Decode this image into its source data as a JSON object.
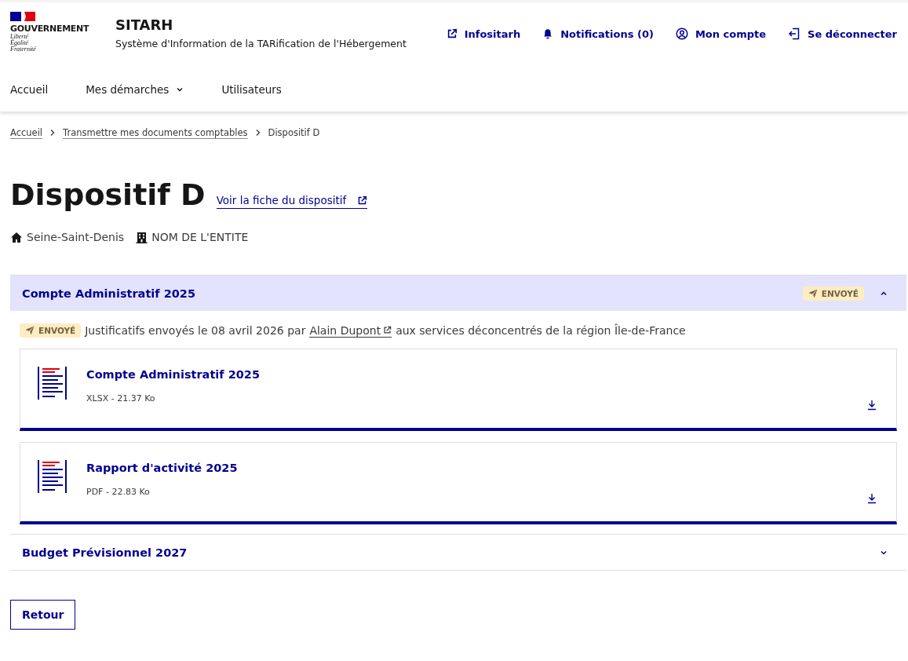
{
  "header": {
    "logo": {
      "title": "GOUVERNEMENT",
      "motto": [
        "Liberté",
        "Égalité",
        "Fraternité"
      ]
    },
    "site_title": "SITARH",
    "site_subtitle": "Système d'Information de la TARification de l'Hébergement",
    "links": [
      {
        "kind": "external",
        "label": "Infositarh"
      },
      {
        "kind": "bell",
        "label": "Notifications (0)"
      },
      {
        "kind": "account",
        "label": "Mon compte"
      },
      {
        "kind": "logout",
        "label": "Se déconnecter"
      }
    ]
  },
  "nav": [
    {
      "label": "Accueil",
      "dropdown": false
    },
    {
      "label": "Mes démarches",
      "dropdown": true
    },
    {
      "label": "Utilisateurs",
      "dropdown": false
    }
  ],
  "breadcrumb": [
    {
      "label": "Accueil",
      "current": false
    },
    {
      "label": "Transmettre mes documents comptables",
      "current": false
    },
    {
      "label": "Dispositif D",
      "current": true
    }
  ],
  "title": "Dispositif D",
  "fiche_link": "Voir la fiche du dispositif",
  "location": "Seine-Saint-Denis",
  "entity": "NOM DE L'ENTITE",
  "sections": [
    {
      "title": "Compte Administratif 2025",
      "expanded": true,
      "status": "ENVOYÉ",
      "notice": {
        "status": "ENVOYÉ",
        "before": "Justificatifs envoyés le 08 avril 2026 par",
        "author": "Alain Dupont",
        "after": "aux services déconcentrés de la région Île-de-France"
      },
      "documents": [
        {
          "title": "Compte Administratif 2025",
          "meta": "XLSX - 21.37 Ko"
        },
        {
          "title": "Rapport d'activité 2025",
          "meta": "PDF - 22.83 Ko"
        }
      ]
    },
    {
      "title": "Budget Prévisionnel 2027",
      "expanded": false
    }
  ],
  "back_button": "Retour"
}
